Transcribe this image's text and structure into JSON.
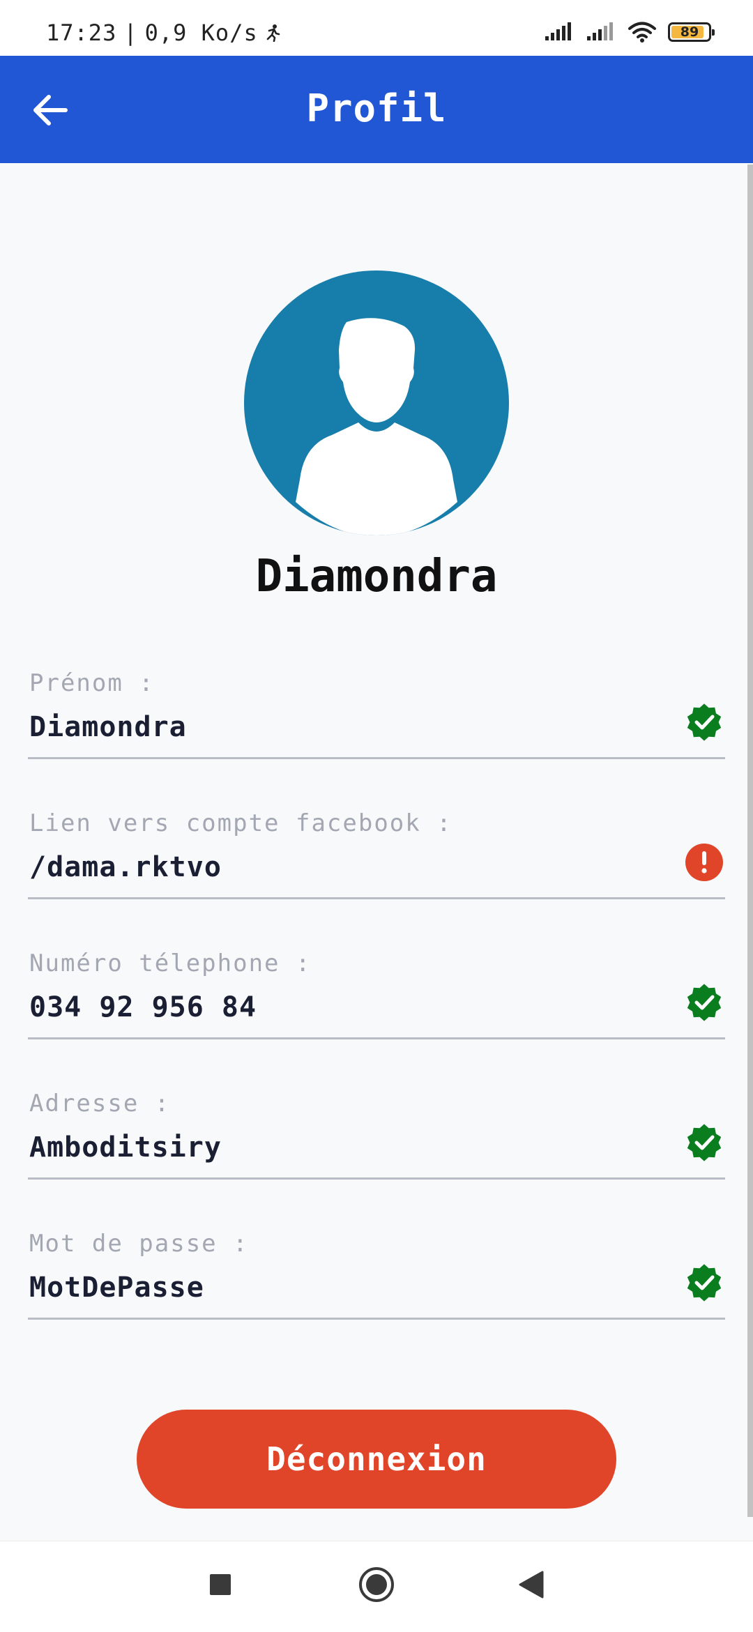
{
  "status_bar": {
    "time": "17:23",
    "separator": "|",
    "net_speed": "0,9 Ko/s",
    "battery_level": "89"
  },
  "header": {
    "title": "Profil",
    "back_icon": "arrow-left-icon"
  },
  "profile": {
    "avatar_icon": "user-silhouette-icon",
    "name": "Diamondra"
  },
  "fields": [
    {
      "label": "Prénom :",
      "value": "Diamondra",
      "status": "valid",
      "status_icon": "verified-check-icon"
    },
    {
      "label": "Lien vers compte facebook :",
      "value": "/dama.rktvo",
      "status": "error",
      "status_icon": "error-exclamation-icon"
    },
    {
      "label": "Numéro télephone :",
      "value": "034 92 956 84",
      "status": "valid",
      "status_icon": "verified-check-icon"
    },
    {
      "label": "Adresse :",
      "value": "Amboditsiry",
      "status": "valid",
      "status_icon": "verified-check-icon"
    },
    {
      "label": "Mot de passe :",
      "value": "MotDePasse",
      "status": "valid",
      "status_icon": "verified-check-icon"
    }
  ],
  "actions": {
    "logout_label": "Déconnexion"
  },
  "colors": {
    "app_bar": "#2156d4",
    "avatar_bg": "#177dab",
    "valid_green": "#0a7d1e",
    "error_red": "#e0452a",
    "logout_button": "#e0452a",
    "label_gray": "#a3a7b2",
    "value_dark": "#1a1f33"
  },
  "nav_bar": {
    "icons": [
      "square-recents-icon",
      "circle-home-icon",
      "triangle-back-icon"
    ]
  }
}
